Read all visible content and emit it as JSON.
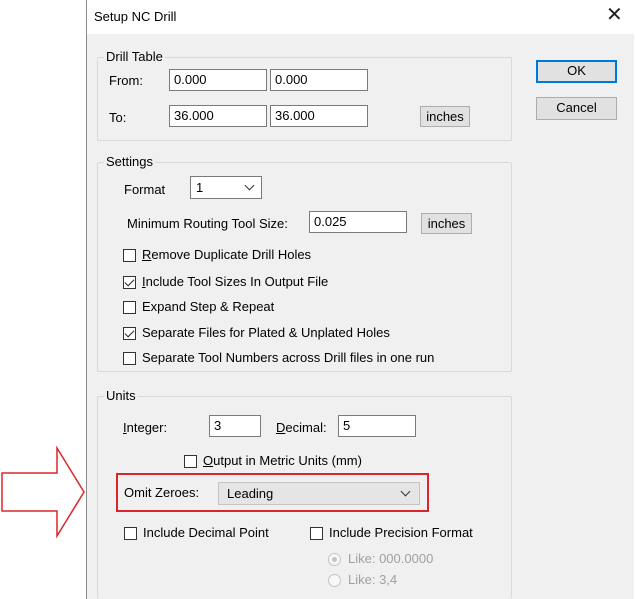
{
  "dialog": {
    "title": "Setup NC Drill",
    "ok_label": "OK",
    "cancel_label": "Cancel"
  },
  "drill_table": {
    "label": "Drill Table",
    "from_label": "From:",
    "to_label": "To:",
    "from_x": "0.000",
    "from_y": "0.000",
    "to_x": "36.000",
    "to_y": "36.000",
    "units_button": "inches"
  },
  "settings": {
    "label": "Settings",
    "format_label": "Format",
    "format_value": "1",
    "min_routing_label": "Minimum Routing Tool Size:",
    "min_routing_value": "0.025",
    "units_button": "inches",
    "checkboxes": [
      {
        "label_prefix": "R",
        "label_rest": "emove Duplicate Drill Holes",
        "checked": false
      },
      {
        "label_prefix": "I",
        "label_rest": "nclude Tool Sizes In Output File",
        "checked": true
      },
      {
        "label_prefix": "",
        "label_rest": "Expand Step & Repeat",
        "checked": false
      },
      {
        "label_prefix": "",
        "label_rest": "Separate Files for Plated & Unplated Holes",
        "checked": true
      },
      {
        "label_prefix": "",
        "label_rest": "Separate Tool Numbers across Drill files in one run",
        "checked": false
      }
    ]
  },
  "units": {
    "label": "Units",
    "integer_prefix": "I",
    "integer_rest": "nteger:",
    "integer_value": "3",
    "decimal_prefix": "D",
    "decimal_rest": "ecimal:",
    "decimal_value": "5",
    "metric_prefix": "O",
    "metric_rest": "utput in Metric Units (mm)",
    "metric_checked": false,
    "omit_label": "Omit Zeroes:",
    "omit_value": "Leading",
    "include_decimal_label": "Include Decimal Point",
    "include_decimal_checked": false,
    "include_precision_label": "Include Precision Format",
    "include_precision_checked": false,
    "radio_options": [
      {
        "label": "Like: 000.0000",
        "selected": true,
        "enabled": false
      },
      {
        "label": "Like: 3,4",
        "selected": false,
        "enabled": false
      }
    ]
  },
  "colors": {
    "highlight": "#d9262b",
    "default_button_border": "#0078d7",
    "dialog_bg": "#f0f0f0"
  }
}
